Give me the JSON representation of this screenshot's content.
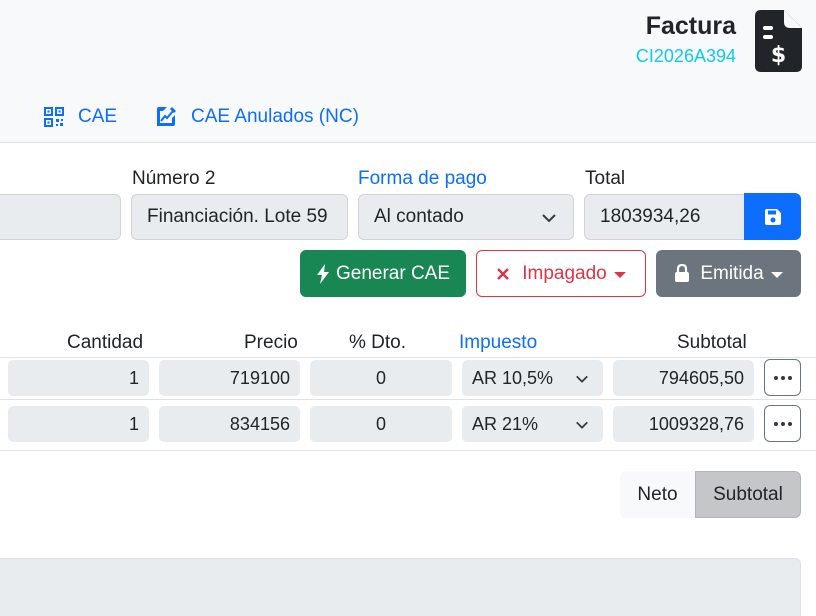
{
  "header": {
    "title": "Factura",
    "code": "CI2026A394",
    "tabs": [
      {
        "label": "CAE",
        "icon": "qr-code-icon"
      },
      {
        "label": "CAE Anulados (NC)",
        "icon": "pencil-chart-icon"
      }
    ]
  },
  "form": {
    "numero2": {
      "label": "Número 2",
      "value": "Financiación. Lote 59"
    },
    "forma_pago": {
      "label": "Forma de pago",
      "value": "Al contado"
    },
    "total": {
      "label": "Total",
      "value": "1803934,26"
    }
  },
  "actions": {
    "generar": "Generar CAE",
    "impagado": "Impagado",
    "emitida": "Emitida"
  },
  "table": {
    "headers": {
      "cantidad": "Cantidad",
      "precio": "Precio",
      "dto": "% Dto.",
      "impuesto": "Impuesto",
      "subtotal": "Subtotal"
    },
    "rows": [
      {
        "cantidad": "1",
        "precio": "719100",
        "dto": "0",
        "impuesto": "AR 10,5%",
        "subtotal": "794605,50"
      },
      {
        "cantidad": "1",
        "precio": "834156",
        "dto": "0",
        "impuesto": "AR 21%",
        "subtotal": "1009328,76"
      }
    ]
  },
  "view_toggle": {
    "neto": "Neto",
    "subtotal": "Subtotal",
    "selected": "Subtotal"
  },
  "colors": {
    "primary": "#0d6efd",
    "success": "#198754",
    "danger": "#dc3545",
    "secondary": "#6c757d",
    "info": "#0dcaf0"
  }
}
